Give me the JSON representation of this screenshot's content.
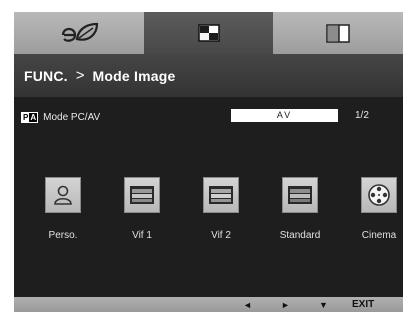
{
  "tabs": [
    {
      "name": "eco",
      "icon": "eco-leaf-icon",
      "active": false
    },
    {
      "name": "picture",
      "icon": "picture-mode-icon",
      "active": true
    },
    {
      "name": "split",
      "icon": "split-screen-icon",
      "active": false
    }
  ],
  "header": {
    "section": "FUNC.",
    "separator": ">",
    "page": "Mode Image"
  },
  "mode": {
    "label": "Mode PC/AV",
    "badge_p": "P",
    "badge_a": "A",
    "value": "AV",
    "page_indicator": "1/2"
  },
  "presets": [
    {
      "label": "Perso.",
      "icon": "person-icon"
    },
    {
      "label": "Vif 1",
      "icon": "monitor-icon"
    },
    {
      "label": "Vif 2",
      "icon": "monitor-icon"
    },
    {
      "label": "Standard",
      "icon": "monitor-icon"
    },
    {
      "label": "Cinema",
      "icon": "film-reel-icon"
    }
  ],
  "nav": {
    "left": "◄",
    "right": "►",
    "down": "▼",
    "exit": "EXIT"
  },
  "colors": {
    "active_tab": "#505050",
    "inactive_tab": "#aaaaaa",
    "background": "#1e1e1e",
    "title_bar": "#3c3c3c"
  }
}
